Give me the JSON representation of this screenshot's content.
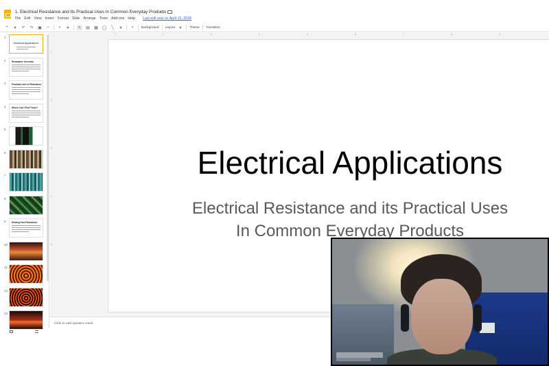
{
  "window": {
    "doc_title": "1. Electrical Resistance and Its Practical Uses In Common Everyday Products",
    "menu": [
      "File",
      "Edit",
      "View",
      "Insert",
      "Format",
      "Slide",
      "Arrange",
      "Tools",
      "Add-ons",
      "Help"
    ],
    "last_edit": "Last edit was on April 15, 2018"
  },
  "toolbar": {
    "background_label": "Background",
    "layout_label": "Layout",
    "theme_label": "Theme",
    "transition_label": "Transition"
  },
  "filmstrip": {
    "slides": [
      {
        "num": "1",
        "kind": "title",
        "title": "Electrical Applications"
      },
      {
        "num": "2",
        "kind": "text",
        "title": "Resistance Overview"
      },
      {
        "num": "3",
        "kind": "text",
        "title": "Practical Uses of Resistance"
      },
      {
        "num": "4",
        "kind": "text",
        "title": "Where Can I Find These?"
      },
      {
        "num": "5",
        "kind": "image",
        "img": "img-phone"
      },
      {
        "num": "6",
        "kind": "image",
        "img": "img-board1"
      },
      {
        "num": "7",
        "kind": "image",
        "img": "img-board2"
      },
      {
        "num": "8",
        "kind": "image",
        "img": "img-board3"
      },
      {
        "num": "9",
        "kind": "text",
        "title": "Heating from Resistance"
      },
      {
        "num": "10",
        "kind": "image",
        "img": "img-heat1"
      },
      {
        "num": "11",
        "kind": "image",
        "img": "img-heat2"
      },
      {
        "num": "12",
        "kind": "image",
        "img": "img-heat3"
      },
      {
        "num": "13",
        "kind": "image",
        "img": "img-heat4"
      }
    ]
  },
  "ruler": {
    "top": [
      "1",
      "2",
      "3",
      "4",
      "5",
      "6",
      "7",
      "8",
      "9"
    ],
    "left": [
      "1",
      "2",
      "3",
      "4",
      "5"
    ]
  },
  "slide": {
    "title": "Electrical Applications",
    "subtitle_line1": "Electrical Resistance and its Practical Uses",
    "subtitle_line2": "In Common Everyday Products"
  },
  "notes": {
    "placeholder": "Click to add speaker notes"
  },
  "colors": {
    "accent": "#f4b400",
    "link": "#1a73e8"
  }
}
